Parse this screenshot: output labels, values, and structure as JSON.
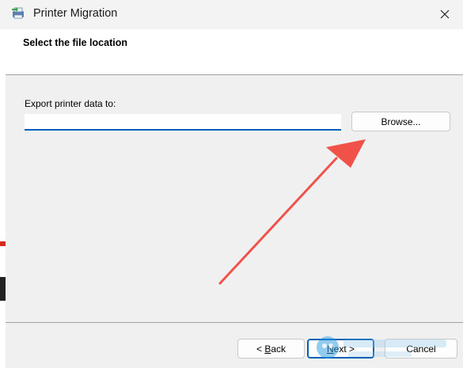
{
  "window": {
    "title": "Printer Migration",
    "close_icon": "close-icon",
    "app_icon": "printer-migration-icon"
  },
  "header": {
    "title": "Select the file location"
  },
  "form": {
    "export_label": "Export printer data to:",
    "export_value": "",
    "browse_label": "Browse..."
  },
  "footer": {
    "back_prefix": "< ",
    "back_mnemonic": "B",
    "back_rest": "ack",
    "next_mnemonic": "N",
    "next_rest": "ext >",
    "cancel_label": "Cancel"
  },
  "annotation": {
    "arrow_color": "#f0524a"
  },
  "colors": {
    "accent": "#005fb8",
    "body_bg": "#f0f0f0"
  }
}
